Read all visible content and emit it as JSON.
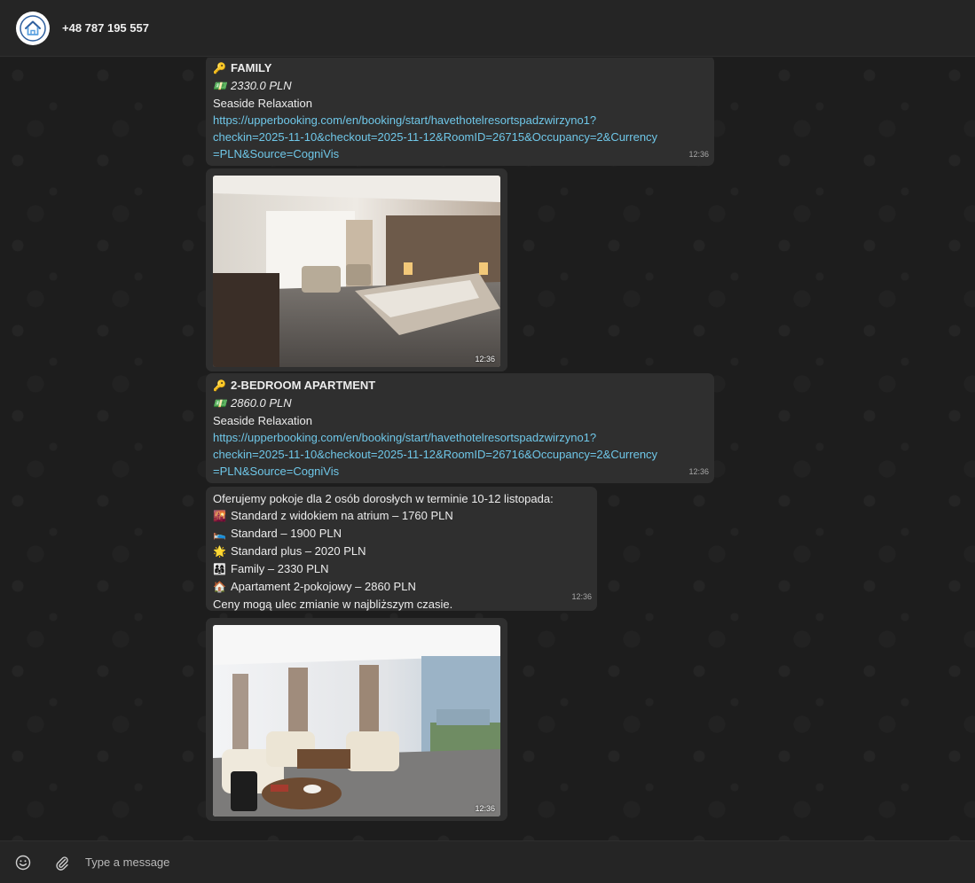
{
  "header": {
    "contact_name": "+48 787 195 557"
  },
  "messages": {
    "family": {
      "title": "FAMILY",
      "price": "2330.0 PLN",
      "description": "Seaside Relaxation",
      "link_lines": [
        "https://upperbooking.com/en/booking/start/havethotelresortspadzwirzyno1?",
        "checkin=2025-11-10&checkout=2025-11-12&RoomID=26715&Occupancy=2&Currency",
        "=PLN&Source=CogniVis"
      ],
      "time": "12:36"
    },
    "image1": {
      "time": "12:36"
    },
    "apartment": {
      "title": "2-BEDROOM APARTMENT",
      "price": "2860.0 PLN",
      "description": "Seaside Relaxation",
      "link_lines": [
        "https://upperbooking.com/en/booking/start/havethotelresortspadzwirzyno1?",
        "checkin=2025-11-10&checkout=2025-11-12&RoomID=26716&Occupancy=2&Currency",
        "=PLN&Source=CogniVis"
      ],
      "time": "12:36"
    },
    "summary": {
      "intro": "Oferujemy pokoje dla 2 osób dorosłych w terminie 10-12 listopada:",
      "items": [
        {
          "emoji": "🌇",
          "text": "Standard z widokiem na atrium – 1760 PLN"
        },
        {
          "emoji": "🛌",
          "text": "Standard – 1900 PLN"
        },
        {
          "emoji": "🌟",
          "text": "Standard plus – 2020 PLN"
        },
        {
          "emoji": "👨‍👩‍👧",
          "text": "Family – 2330 PLN"
        },
        {
          "emoji": "🏠",
          "text": "Apartament 2-pokojowy – 2860 PLN"
        }
      ],
      "outro": "Ceny mogą ulec zmianie w najbliższym czasie.",
      "time": "12:36"
    },
    "image2": {
      "time": "12:36"
    }
  },
  "icons": {
    "key": "🔑",
    "money": "💵"
  },
  "composer": {
    "placeholder": "Type a message"
  }
}
